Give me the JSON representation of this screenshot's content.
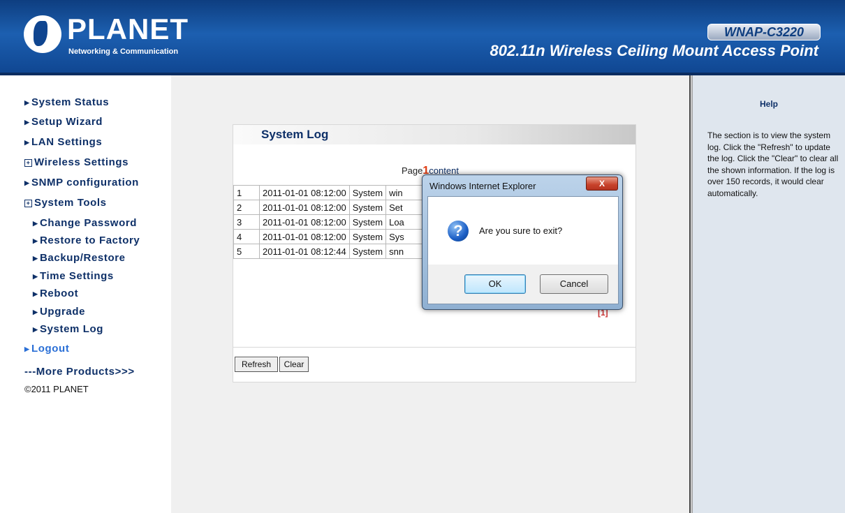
{
  "header": {
    "logo_text": "PLANET",
    "logo_sub": "Networking & Communication",
    "model": "WNAP-C3220",
    "product_title": "802.11n Wireless Ceiling Mount Access Point"
  },
  "sidebar": {
    "items": [
      {
        "label": "System Status",
        "mark": "▶"
      },
      {
        "label": "Setup Wizard",
        "mark": "▶"
      },
      {
        "label": "LAN Settings",
        "mark": "▶"
      },
      {
        "label": "Wireless Settings",
        "mark": "+"
      },
      {
        "label": "SNMP configuration",
        "mark": "▶"
      },
      {
        "label": "System Tools",
        "mark": "+"
      }
    ],
    "sub_items": [
      {
        "label": "Change Password",
        "mark": "▶"
      },
      {
        "label": "Restore to Factory",
        "mark": "▶"
      },
      {
        "label": "Backup/Restore",
        "mark": "▶"
      },
      {
        "label": "Time Settings",
        "mark": "▶"
      },
      {
        "label": "Reboot",
        "mark": "▶"
      },
      {
        "label": "Upgrade",
        "mark": "▶"
      },
      {
        "label": "System Log",
        "mark": "▶"
      }
    ],
    "logout": {
      "label": "Logout",
      "mark": "▶"
    },
    "more_products": "---More Products>>>",
    "copyright": "©2011 PLANET"
  },
  "main": {
    "title": "System Log",
    "page_prefix": "Page",
    "page_number": "1",
    "page_suffix": "content",
    "log_rows": [
      {
        "index": "1",
        "time": "2011-01-01 08:12:00",
        "source": "System",
        "message": "win"
      },
      {
        "index": "2",
        "time": "2011-01-01 08:12:00",
        "source": "System",
        "message": "Set"
      },
      {
        "index": "3",
        "time": "2011-01-01 08:12:00",
        "source": "System",
        "message": "Loa"
      },
      {
        "index": "4",
        "time": "2011-01-01 08:12:00",
        "source": "System",
        "message": "Sys"
      },
      {
        "index": "5",
        "time": "2011-01-01 08:12:44",
        "source": "System",
        "message": "snn"
      }
    ],
    "pager_fragment": "[1]",
    "refresh_label": "Refresh",
    "clear_label": "Clear"
  },
  "help": {
    "title": "Help",
    "text": "The section is to view the system log. Click the \"Refresh\" to update the log. Click the \"Clear\" to clear all the shown information. If the log is over 150 records, it would clear automatically."
  },
  "dialog": {
    "title": "Windows Internet Explorer",
    "close_glyph": "X",
    "icon": "question-icon",
    "icon_glyph": "?",
    "message": "Are you sure to exit?",
    "ok_label": "OK",
    "cancel_label": "Cancel"
  }
}
